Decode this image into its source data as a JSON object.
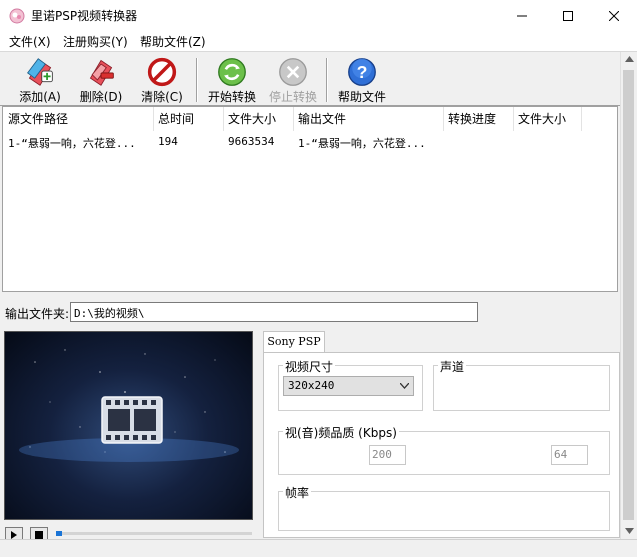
{
  "window": {
    "title": "里诺PSP视频转换器",
    "minimize_icon": "minimize-icon",
    "maximize_icon": "maximize-icon",
    "close_icon": "close-icon"
  },
  "menu": [
    {
      "label": "文件(X)"
    },
    {
      "label": "注册购买(Y)"
    },
    {
      "label": "帮助文件(Z)"
    }
  ],
  "toolbar": {
    "add": {
      "label": "添加(A)",
      "icon": "add-file-icon"
    },
    "delete": {
      "label": "删除(D)",
      "icon": "delete-file-icon"
    },
    "clear": {
      "label": "清除(C)",
      "icon": "clear-icon"
    },
    "start": {
      "label": "开始转换",
      "icon": "start-convert-icon"
    },
    "stop": {
      "label": "停止转换",
      "icon": "stop-convert-icon",
      "disabled": true
    },
    "help": {
      "label": "帮助文件",
      "icon": "help-icon"
    }
  },
  "file_list": {
    "columns": [
      "源文件路径",
      "总时间",
      "文件大小",
      "输出文件",
      "转换进度",
      "文件大小"
    ],
    "rows": [
      {
        "source": "1-“悬弱一响，六花登...",
        "duration": "194",
        "size": "9663534",
        "output": "1-“悬弱一响，六花登...",
        "progress": "",
        "out_size": ""
      }
    ]
  },
  "output_folder": {
    "label": "输出文件夹:",
    "value": "D:\\我的视频\\"
  },
  "player": {
    "play_icon": "play-icon",
    "stop_icon": "stop-icon",
    "seek_progress": 0.03
  },
  "settings": {
    "tab": "Sony PSP",
    "video_size": {
      "label": "视频尺寸",
      "value": "320x240"
    },
    "audio_channel": {
      "label": "声道"
    },
    "quality": {
      "label": "视(音)频品质 (Kbps)",
      "video_value": "200",
      "audio_value": "64"
    },
    "frame_rate": {
      "label": "帧率"
    }
  },
  "colors": {
    "accent": "#1a74d6",
    "preview_bg": "#14213f"
  }
}
